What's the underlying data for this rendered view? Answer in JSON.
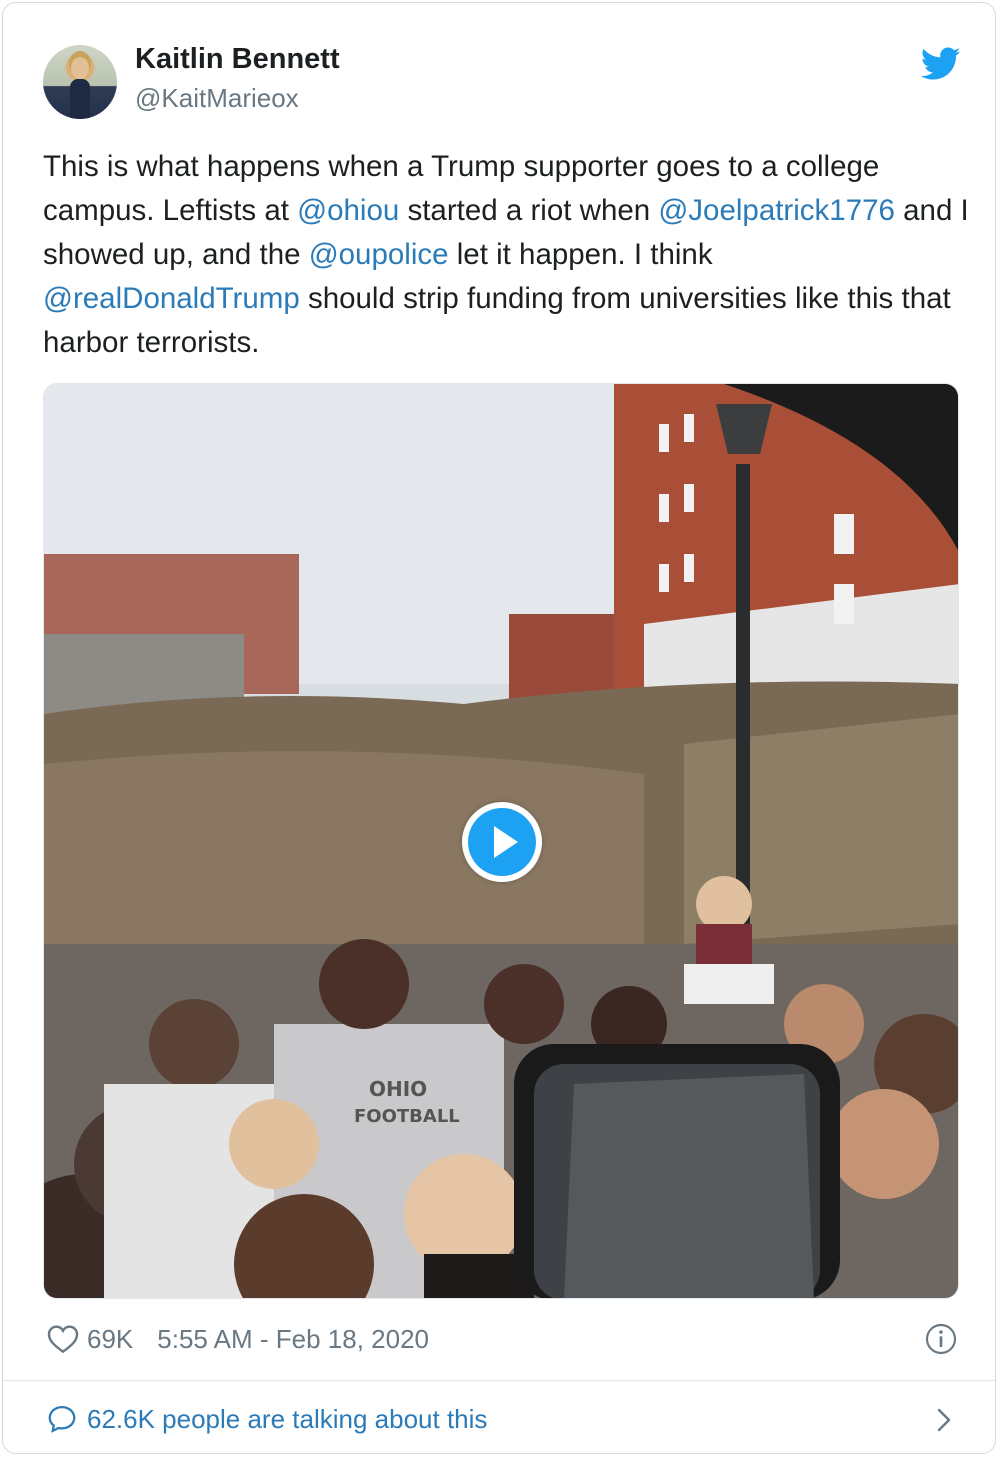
{
  "author": {
    "name": "Kaitlin Bennett",
    "handle": "@KaitMarieox"
  },
  "tweet": {
    "segments": [
      {
        "text": "This is what happens when a Trump supporter goes to a college campus. Leftists at ",
        "mention": false
      },
      {
        "text": "@ohiou",
        "mention": true
      },
      {
        "text": " started a riot when ",
        "mention": false
      },
      {
        "text": "@Joelpatrick1776",
        "mention": true
      },
      {
        "text": " and I showed up, and the ",
        "mention": false
      },
      {
        "text": "@oupolice",
        "mention": true
      },
      {
        "text": " let it happen. I think ",
        "mention": false
      },
      {
        "text": "@realDonaldTrump",
        "mention": true
      },
      {
        "text": " should strip funding from universities like this that harbor terrorists.",
        "mention": false
      }
    ]
  },
  "media": {
    "shirt_text_line1": "OHIO",
    "shirt_text_line2": "FOOTBALL"
  },
  "footer": {
    "likes": "69K",
    "timestamp": "5:55 AM - Feb 18, 2020",
    "talking": "62.6K people are talking about this"
  },
  "icons": {
    "brand": "twitter-bird-icon",
    "like": "heart-icon",
    "info": "info-icon",
    "reply": "speech-bubble-icon",
    "more": "chevron-right-icon"
  },
  "colors": {
    "link": "#2b7bb9",
    "brand": "#1da1f2",
    "muted": "#697882",
    "text": "#1c2022"
  }
}
